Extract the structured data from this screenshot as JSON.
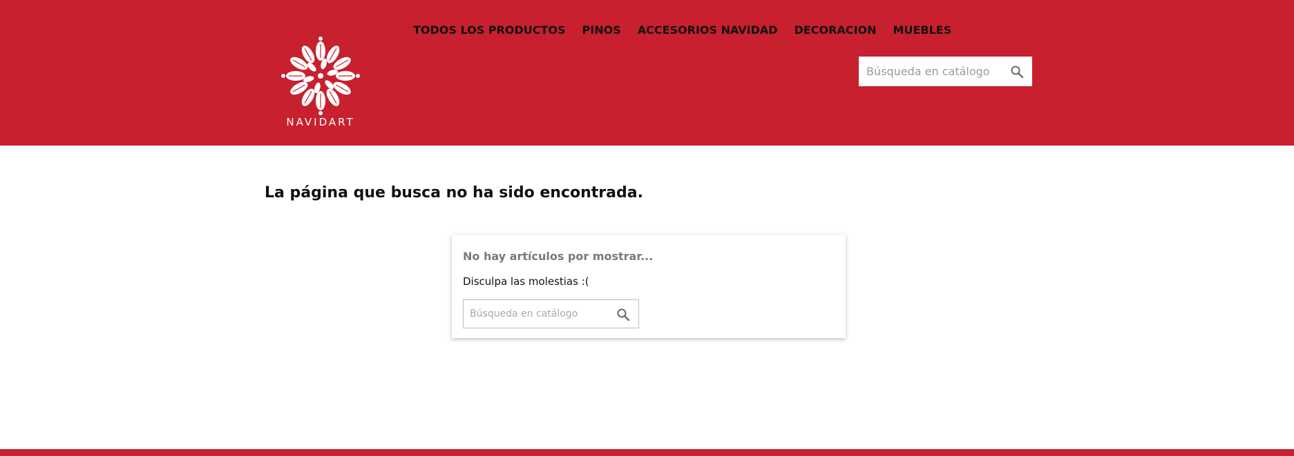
{
  "brand": {
    "name": "NAVIDART",
    "logo_icon": "snowflake-leaf-logo-icon",
    "color": "#c8202e"
  },
  "nav": {
    "items": [
      {
        "label": "TODOS LOS PRODUCTOS"
      },
      {
        "label": "PINOS"
      },
      {
        "label": "ACCESORIOS NAVIDAD"
      },
      {
        "label": "DECORACION"
      },
      {
        "label": "MUEBLES"
      }
    ]
  },
  "header_search": {
    "placeholder": "Búsqueda en catálogo",
    "value": "",
    "icon": "search-icon"
  },
  "main": {
    "title": "La página que busca no ha sido encontrada.",
    "card": {
      "heading": "No hay artículos por mostrar...",
      "text": "Disculpa las molestias :(",
      "search": {
        "placeholder": "Búsqueda en catálogo",
        "value": "",
        "icon": "search-icon"
      }
    }
  }
}
